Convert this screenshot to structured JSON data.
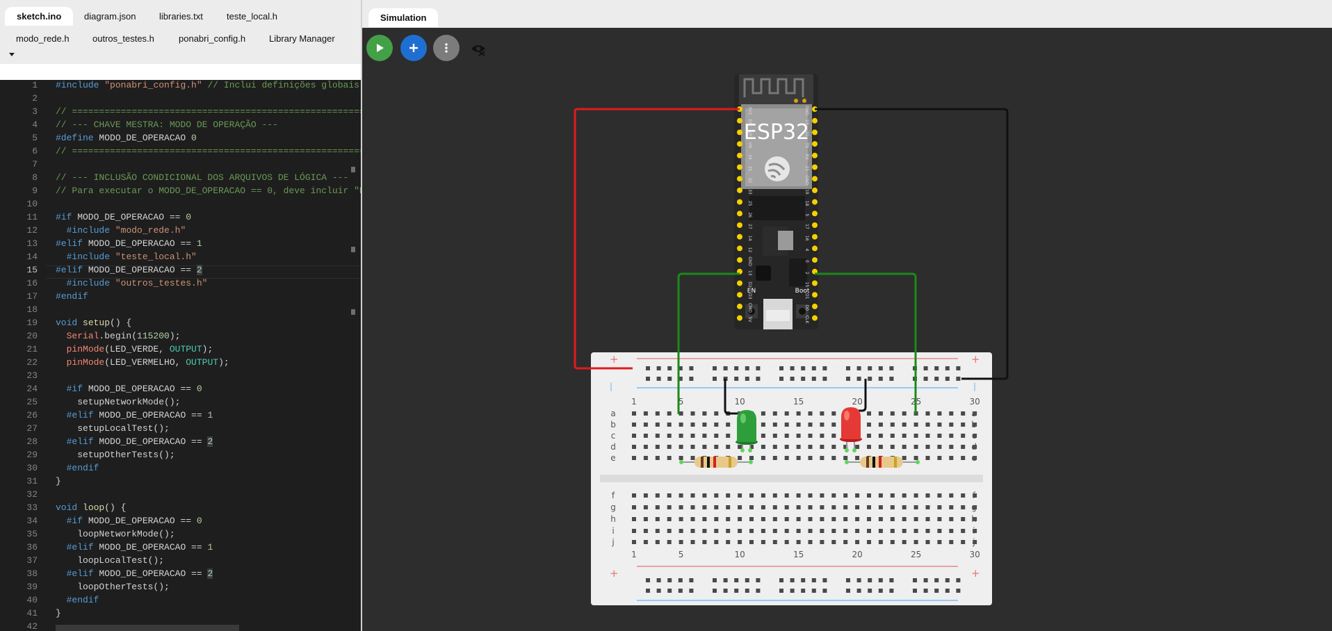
{
  "editor": {
    "tabs_row1": [
      {
        "label": "sketch.ino",
        "active": true
      },
      {
        "label": "diagram.json",
        "active": false
      },
      {
        "label": "libraries.txt",
        "active": false
      },
      {
        "label": "teste_local.h",
        "active": false
      }
    ],
    "tabs_row2": [
      {
        "label": "modo_rede.h"
      },
      {
        "label": "outros_testes.h"
      },
      {
        "label": "ponabri_config.h"
      },
      {
        "label": "Library Manager"
      }
    ],
    "current_line": 15,
    "lines": [
      "#include \"ponabri_config.h\" // Inclui definições globais",
      "",
      "// ===========================================================",
      "// --- CHAVE MESTRA: MODO DE OPERAÇÃO ---",
      "#define MODO_DE_OPERACAO 0",
      "// ===========================================================",
      "",
      "// --- INCLUSÃO CONDICIONAL DOS ARQUIVOS DE LÓGICA ---",
      "// Para executar o MODO_DE_OPERACAO == 0, deve incluir \"P",
      "",
      "#if MODO_DE_OPERACAO == 0",
      "  #include \"modo_rede.h\"",
      "#elif MODO_DE_OPERACAO == 1",
      "  #include \"teste_local.h\"",
      "#elif MODO_DE_OPERACAO == 2",
      "  #include \"outros_testes.h\"",
      "#endif",
      "",
      "void setup() {",
      "  Serial.begin(115200);",
      "  pinMode(LED_VERDE, OUTPUT);",
      "  pinMode(LED_VERMELHO, OUTPUT);",
      "",
      "  #if MODO_DE_OPERACAO == 0",
      "    setupNetworkMode();",
      "  #elif MODO_DE_OPERACAO == 1",
      "    setupLocalTest();",
      "  #elif MODO_DE_OPERACAO == 2",
      "    setupOtherTests();",
      "  #endif",
      "}",
      "",
      "void loop() {",
      "  #if MODO_DE_OPERACAO == 0",
      "    loopNetworkMode();",
      "  #elif MODO_DE_OPERACAO == 1",
      "    loopLocalTest();",
      "  #elif MODO_DE_OPERACAO == 2",
      "    loopOtherTests();",
      "  #endif",
      "}",
      ""
    ]
  },
  "simulation": {
    "tab_label": "Simulation",
    "toolbar": {
      "play_icon": "play-icon",
      "add_icon": "plus-icon",
      "more_icon": "more-vert-icon",
      "hide_icon": "eye-off-icon"
    },
    "esp32": {
      "label": "ESP32",
      "en_label": "EN",
      "boot_label": "Boot",
      "left_pins": [
        "3V3",
        "EN",
        "VP",
        "VN",
        "34",
        "35",
        "32",
        "33",
        "25",
        "26",
        "27",
        "14",
        "12",
        "GND",
        "13",
        "D2",
        "D3",
        "CMD",
        "5V"
      ],
      "right_pins": [
        "GND",
        "23",
        "22",
        "TX",
        "RX",
        "21",
        "GND",
        "19",
        "18",
        "5",
        "17",
        "16",
        "4",
        "0",
        "2",
        "15",
        "D1",
        "D0",
        "CLK"
      ]
    },
    "breadboard": {
      "columns_top": [
        "1",
        "5",
        "10",
        "15",
        "20",
        "25",
        "30"
      ],
      "columns_bottom": [
        "1",
        "5",
        "10",
        "15",
        "20",
        "25",
        "30"
      ],
      "rows_top": [
        "a",
        "b",
        "c",
        "d",
        "e"
      ],
      "rows_bottom": [
        "f",
        "g",
        "h",
        "i",
        "j"
      ],
      "plus_symbol": "+",
      "minus_symbol": "|"
    },
    "components": {
      "led_green_color": "#2e9e3a",
      "led_red_color": "#e53935"
    },
    "wire_colors": {
      "red": "#e01b1b",
      "black": "#111111",
      "green": "#1a8a1a"
    }
  }
}
